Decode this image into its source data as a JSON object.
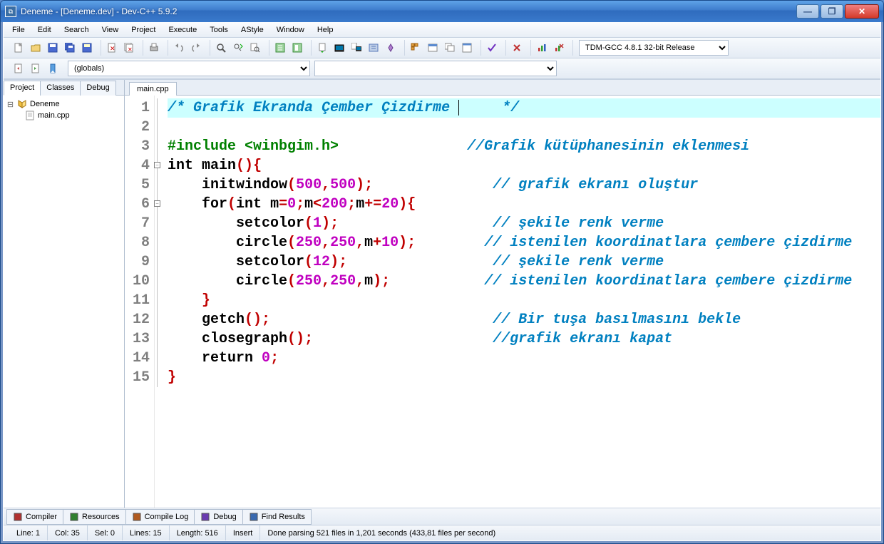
{
  "window": {
    "title": "Deneme - [Deneme.dev] - Dev-C++ 5.9.2"
  },
  "menu": [
    "File",
    "Edit",
    "Search",
    "View",
    "Project",
    "Execute",
    "Tools",
    "AStyle",
    "Window",
    "Help"
  ],
  "compiler_dropdown": "TDM-GCC 4.8.1 32-bit Release",
  "class_dropdown": "(globals)",
  "left_tabs": [
    "Project",
    "Classes",
    "Debug"
  ],
  "project_tree": {
    "root": "Deneme",
    "file": "main.cpp"
  },
  "editor_tab": "main.cpp",
  "code_lines": [
    {
      "n": 1,
      "hl": true,
      "fold": "",
      "segs": [
        [
          "c-comment",
          "/* Grafik Ekranda Çember Çizdirme "
        ],
        [
          "caret",
          ""
        ],
        [
          "c-comment",
          "     */"
        ]
      ]
    },
    {
      "n": 2,
      "segs": [
        [
          "",
          ""
        ]
      ]
    },
    {
      "n": 3,
      "segs": [
        [
          "c-pre",
          "#include <winbgim.h>"
        ],
        [
          "pad",
          "               "
        ],
        [
          "c-comment",
          "//Grafik kütüphanesinin eklenmesi"
        ]
      ]
    },
    {
      "n": 4,
      "fold": "-",
      "segs": [
        [
          "c-kw",
          "int"
        ],
        [
          "",
          " "
        ],
        [
          "c-fn",
          "main"
        ],
        [
          "c-punc",
          "()"
        ],
        [
          "c-punc",
          "{"
        ]
      ]
    },
    {
      "n": 5,
      "segs": [
        [
          "",
          "    "
        ],
        [
          "c-fn",
          "initwindow"
        ],
        [
          "c-punc",
          "("
        ],
        [
          "c-num",
          "500"
        ],
        [
          "c-punc",
          ","
        ],
        [
          "c-num",
          "500"
        ],
        [
          "c-punc",
          ")"
        ],
        [
          "c-punc",
          ";"
        ],
        [
          "pad",
          "              "
        ],
        [
          "c-comment",
          "// grafik ekranı oluştur"
        ]
      ]
    },
    {
      "n": 6,
      "fold": "-",
      "segs": [
        [
          "",
          "    "
        ],
        [
          "c-kw",
          "for"
        ],
        [
          "c-punc",
          "("
        ],
        [
          "c-kw",
          "int"
        ],
        [
          "",
          " m"
        ],
        [
          "c-punc",
          "="
        ],
        [
          "c-num",
          "0"
        ],
        [
          "c-punc",
          ";"
        ],
        [
          "",
          "m"
        ],
        [
          "c-punc",
          "<"
        ],
        [
          "c-num",
          "200"
        ],
        [
          "c-punc",
          ";"
        ],
        [
          "",
          "m"
        ],
        [
          "c-punc",
          "+="
        ],
        [
          "c-num",
          "20"
        ],
        [
          "c-punc",
          ")"
        ],
        [
          "c-punc",
          "{"
        ]
      ]
    },
    {
      "n": 7,
      "segs": [
        [
          "",
          "        "
        ],
        [
          "c-fn",
          "setcolor"
        ],
        [
          "c-punc",
          "("
        ],
        [
          "c-num",
          "1"
        ],
        [
          "c-punc",
          ")"
        ],
        [
          "c-punc",
          ";"
        ],
        [
          "pad",
          "                  "
        ],
        [
          "c-comment",
          "// şekile renk verme"
        ]
      ]
    },
    {
      "n": 8,
      "segs": [
        [
          "",
          "        "
        ],
        [
          "c-fn",
          "circle"
        ],
        [
          "c-punc",
          "("
        ],
        [
          "c-num",
          "250"
        ],
        [
          "c-punc",
          ","
        ],
        [
          "c-num",
          "250"
        ],
        [
          "c-punc",
          ","
        ],
        [
          "",
          "m"
        ],
        [
          "c-punc",
          "+"
        ],
        [
          "c-num",
          "10"
        ],
        [
          "c-punc",
          ")"
        ],
        [
          "c-punc",
          ";"
        ],
        [
          "pad",
          "        "
        ],
        [
          "c-comment",
          "// istenilen koordinatlara çembere çizdirme"
        ]
      ]
    },
    {
      "n": 9,
      "segs": [
        [
          "",
          "        "
        ],
        [
          "c-fn",
          "setcolor"
        ],
        [
          "c-punc",
          "("
        ],
        [
          "c-num",
          "12"
        ],
        [
          "c-punc",
          ")"
        ],
        [
          "c-punc",
          ";"
        ],
        [
          "pad",
          "                 "
        ],
        [
          "c-comment",
          "// şekile renk verme"
        ]
      ]
    },
    {
      "n": 10,
      "segs": [
        [
          "",
          "        "
        ],
        [
          "c-fn",
          "circle"
        ],
        [
          "c-punc",
          "("
        ],
        [
          "c-num",
          "250"
        ],
        [
          "c-punc",
          ","
        ],
        [
          "c-num",
          "250"
        ],
        [
          "c-punc",
          ","
        ],
        [
          "",
          "m"
        ],
        [
          "c-punc",
          ")"
        ],
        [
          "c-punc",
          ";"
        ],
        [
          "pad",
          "           "
        ],
        [
          "c-comment",
          "// istenilen koordinatlara çembere çizdirme"
        ]
      ]
    },
    {
      "n": 11,
      "segs": [
        [
          "",
          "    "
        ],
        [
          "c-punc",
          "}"
        ]
      ]
    },
    {
      "n": 12,
      "segs": [
        [
          "",
          "    "
        ],
        [
          "c-fn",
          "getch"
        ],
        [
          "c-punc",
          "()"
        ],
        [
          "c-punc",
          ";"
        ],
        [
          "pad",
          "                          "
        ],
        [
          "c-comment",
          "// Bir tuşa basılmasını bekle"
        ]
      ]
    },
    {
      "n": 13,
      "segs": [
        [
          "",
          "    "
        ],
        [
          "c-fn",
          "closegraph"
        ],
        [
          "c-punc",
          "()"
        ],
        [
          "c-punc",
          ";"
        ],
        [
          "pad",
          "                     "
        ],
        [
          "c-comment",
          "//grafik ekranı kapat"
        ]
      ]
    },
    {
      "n": 14,
      "segs": [
        [
          "",
          "    "
        ],
        [
          "c-kw",
          "return"
        ],
        [
          "",
          " "
        ],
        [
          "c-num",
          "0"
        ],
        [
          "c-punc",
          ";"
        ]
      ]
    },
    {
      "n": 15,
      "segs": [
        [
          "c-punc",
          "}"
        ]
      ]
    }
  ],
  "bottom_tabs": [
    {
      "icon": "#b03030",
      "label": "Compiler"
    },
    {
      "icon": "#308030",
      "label": "Resources"
    },
    {
      "icon": "#b05a20",
      "label": "Compile Log"
    },
    {
      "icon": "#6a3ab0",
      "label": "Debug"
    },
    {
      "icon": "#3a6ab0",
      "label": "Find Results"
    }
  ],
  "status": {
    "line": "Line:   1",
    "col": "Col:   35",
    "sel": "Sel:   0",
    "lines": "Lines:   15",
    "length": "Length:   516",
    "mode": "Insert",
    "msg": "Done parsing 521 files in 1,201 seconds (433,81 files per second)"
  }
}
